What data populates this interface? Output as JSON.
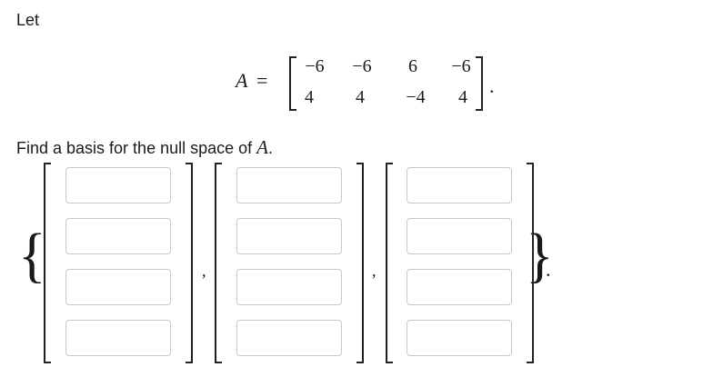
{
  "intro_text": "Let",
  "equation": {
    "lhs": "A",
    "equals": "=",
    "period": "."
  },
  "matrix": [
    [
      "−6",
      "−6",
      "6",
      "−6"
    ],
    [
      "4",
      "4",
      "−4",
      "4"
    ]
  ],
  "prompt": {
    "text": "Find a basis for the null space of",
    "var": "A",
    "end": "."
  },
  "set": {
    "open": "{",
    "close": "}",
    "comma": ",",
    "period": "."
  },
  "basis_inputs": [
    [
      "",
      "",
      "",
      ""
    ],
    [
      "",
      "",
      "",
      ""
    ],
    [
      "",
      "",
      "",
      ""
    ]
  ]
}
